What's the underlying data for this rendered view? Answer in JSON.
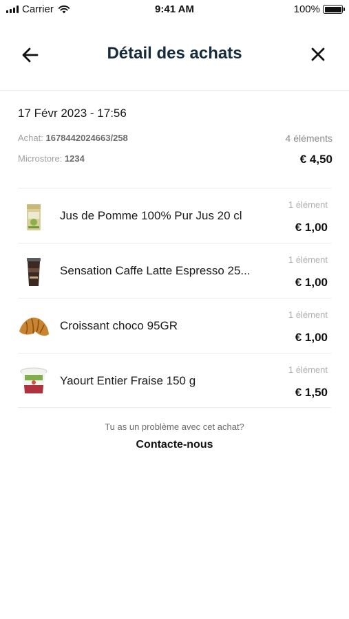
{
  "status_bar": {
    "carrier": "Carrier",
    "time": "9:41 AM",
    "battery": "100%"
  },
  "header": {
    "title": "Détail des achats",
    "back_icon": "arrow-left-icon",
    "close_icon": "close-icon"
  },
  "summary": {
    "date": "17 Févr 2023 - 17:56",
    "purchase_label": "Achat:",
    "purchase_id": "1678442024663/258",
    "microstore_label": "Microstore:",
    "microstore_id": "1234",
    "item_count": "4 éléments",
    "total": "€ 4,50"
  },
  "items": [
    {
      "name": "Jus de Pomme 100% Pur Jus 20 cl",
      "qty": "1 élément",
      "price": "€ 1,00",
      "icon": "juice-carton-icon"
    },
    {
      "name": "Sensation Caffe Latte Espresso 25...",
      "qty": "1 élément",
      "price": "€ 1,00",
      "icon": "coffee-cup-icon"
    },
    {
      "name": "Croissant choco 95GR",
      "qty": "1 élément",
      "price": "€ 1,00",
      "icon": "croissant-icon"
    },
    {
      "name": "Yaourt Entier Fraise 150 g",
      "qty": "1 élément",
      "price": "€ 1,50",
      "icon": "yogurt-cup-icon"
    }
  ],
  "help": {
    "question": "Tu as un problème avec cet achat?",
    "contact_label": "Contacte-nous"
  },
  "colors": {
    "title": "#152a3a",
    "muted": "#a0a0a0",
    "divider": "#ededed"
  }
}
